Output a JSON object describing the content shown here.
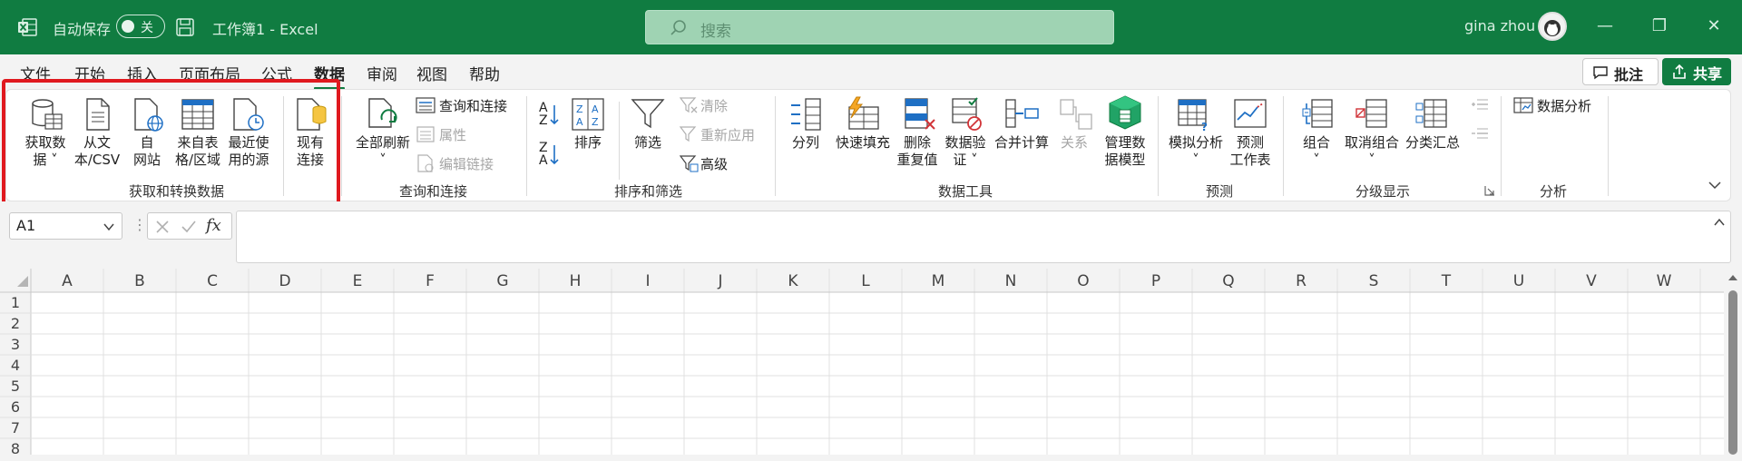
{
  "titlebar": {
    "autosave_label": "自动保存",
    "autosave_state": "关",
    "doc_title": "工作簿1  -  Excel",
    "search_placeholder": "搜索",
    "user_name": "gina zhou"
  },
  "menubar": {
    "tabs": [
      "文件",
      "开始",
      "插入",
      "页面布局",
      "公式",
      "数据",
      "审阅",
      "视图",
      "帮助"
    ],
    "active_tab": "数据",
    "comment_label": "批注",
    "share_label": "共享"
  },
  "ribbon": {
    "get_transform": {
      "label": "获取和转换数据",
      "buttons": [
        "获取数\n据 ˅",
        "从文\n本/CSV",
        "自\n网站",
        "来自表\n格/区域",
        "最近使\n用的源",
        "现有\n连接"
      ]
    },
    "queries": {
      "label": "查询和连接",
      "refresh_all": "全部刷新\n˅",
      "queries_connections": "查询和连接",
      "properties": "属性",
      "edit_links": "编辑链接"
    },
    "sort_filter": {
      "label": "排序和筛选",
      "sort": "排序",
      "filter": "筛选",
      "clear": "清除",
      "reapply": "重新应用",
      "advanced": "高级"
    },
    "data_tools": {
      "label": "数据工具",
      "buttons": [
        "分列",
        "快速填充",
        "删除\n重复值",
        "数据验\n证 ˅",
        "合并计算",
        "关系",
        "管理数\n据模型"
      ]
    },
    "forecast": {
      "label": "预测",
      "whatif": "模拟分析\n˅",
      "forecast_sheet": "预测\n工作表"
    },
    "outline": {
      "label": "分级显示",
      "group": "组合\n˅",
      "ungroup": "取消组合\n˅",
      "subtotal": "分类汇总"
    },
    "analysis": {
      "label": "分析",
      "data_analysis": "数据分析"
    }
  },
  "formula_bar": {
    "name_box": "A1",
    "fx": "fx"
  },
  "sheet": {
    "columns": [
      "A",
      "B",
      "C",
      "D",
      "E",
      "F",
      "G",
      "H",
      "I",
      "J",
      "K",
      "L",
      "M",
      "N",
      "O",
      "P",
      "Q",
      "R",
      "S",
      "T",
      "U",
      "V",
      "W"
    ],
    "rows": [
      "1",
      "2",
      "3",
      "4",
      "5",
      "6",
      "7",
      "8"
    ]
  },
  "colors": {
    "accent": "#107c41",
    "highlight": "#e0191f"
  }
}
